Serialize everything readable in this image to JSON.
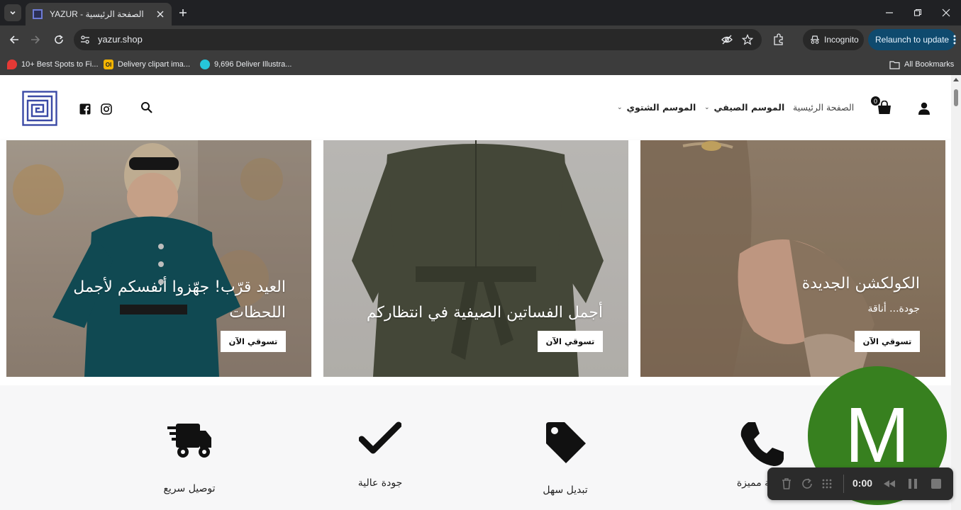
{
  "browser": {
    "tab": {
      "title": "YAZUR - الصفحة الرئيسية"
    },
    "url": "yazur.shop",
    "incognito_label": "Incognito",
    "relaunch_label": "Relaunch to update",
    "bookmarks": [
      {
        "label": "10+ Best Spots to Fi...",
        "icon": "location-pin-icon",
        "color": "#e53935"
      },
      {
        "label": "Delivery clipart ima...",
        "icon": "clipart-icon",
        "color": "#f4b400"
      },
      {
        "label": "9,696 Deliver Illustra...",
        "icon": "illustration-icon",
        "color": "#26c6da"
      }
    ],
    "all_bookmarks_label": "All Bookmarks"
  },
  "header": {
    "nav": {
      "home": "الصفحة الرئيسية",
      "summer": "الموسم الصيفي",
      "winter": "الموسم الشتوي"
    },
    "cart_count": "0"
  },
  "banners": [
    {
      "title_line1": "العيد قرّب! جهّزوا أنفسكم لأجمل",
      "title_line2": "اللحظات",
      "button": "تسوقي الآن"
    },
    {
      "title_line1": "أجمل الفساتين الصيفية في انتظاركم",
      "button": "تسوقي الآن"
    },
    {
      "title_line1": "الكولكشن الجديدة",
      "subtitle": "جودة... أناقة",
      "button": "تسوقي الآن"
    }
  ],
  "features": [
    {
      "label": "توصيل سريع",
      "icon": "delivery-truck-icon"
    },
    {
      "label": "جودة عالية",
      "icon": "checkmark-icon"
    },
    {
      "label": "تبديل سهل",
      "icon": "price-tag-icon"
    },
    {
      "label": "خدمة مميزة",
      "icon": "phone-icon"
    }
  ],
  "recorder": {
    "avatar_letter": "M",
    "time": "0:00",
    "avatar_color": "#37801f"
  }
}
